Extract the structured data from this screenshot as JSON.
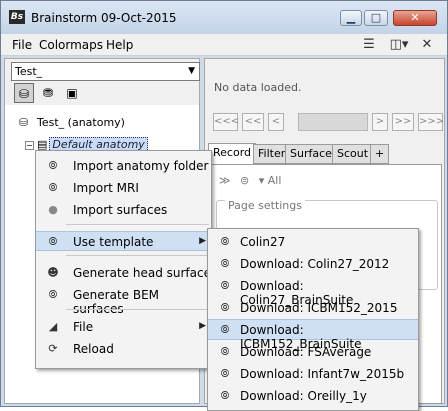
{
  "window": {
    "title": "Brainstorm 09-Oct-2015",
    "logo_text": "Bs"
  },
  "menubar": {
    "items": [
      "File",
      "Colormaps",
      "Help"
    ]
  },
  "protocol_combo": {
    "value": "Test_"
  },
  "tree": {
    "subject": "Test_ (anatomy)",
    "anatomy": "Default anatomy",
    "toggle": "−"
  },
  "right": {
    "no_data": "No data loaded.",
    "nav": [
      "<<<",
      "<<",
      "<",
      ">",
      ">>",
      ">>>"
    ],
    "tabs": [
      "Record",
      "Filter",
      "Surface",
      "Scout",
      "+"
    ],
    "toolbar_all": "All",
    "page_settings": "Page settings"
  },
  "context_menu": {
    "items": [
      {
        "label": "Import anatomy folder",
        "icon": "brain-icon"
      },
      {
        "label": "Import MRI",
        "icon": "brain-icon"
      },
      {
        "label": "Import surfaces",
        "icon": "dot-icon"
      },
      {
        "label": "Use template",
        "icon": "brain-icon",
        "submenu": true
      },
      {
        "label": "Generate head surface",
        "icon": "head-icon"
      },
      {
        "label": "Generate BEM surfaces",
        "icon": "brain-icon"
      },
      {
        "label": "File",
        "icon": "file-icon",
        "submenu": true
      },
      {
        "label": "Reload",
        "icon": "reload-icon"
      }
    ]
  },
  "template_submenu": {
    "items": [
      "Colin27",
      "Download: Colin27_2012",
      "Download: Colin27_BrainSuite",
      "Download: ICBM152_2015",
      "Download: ICBM152_BrainSuite",
      "Download: FSAverage",
      "Download: Infant7w_2015b",
      "Download: Oreilly_1y"
    ]
  },
  "colors": {
    "highlight": "#cfe0f5",
    "title_bg": "#cfdbe8",
    "close": "#c7442c"
  }
}
